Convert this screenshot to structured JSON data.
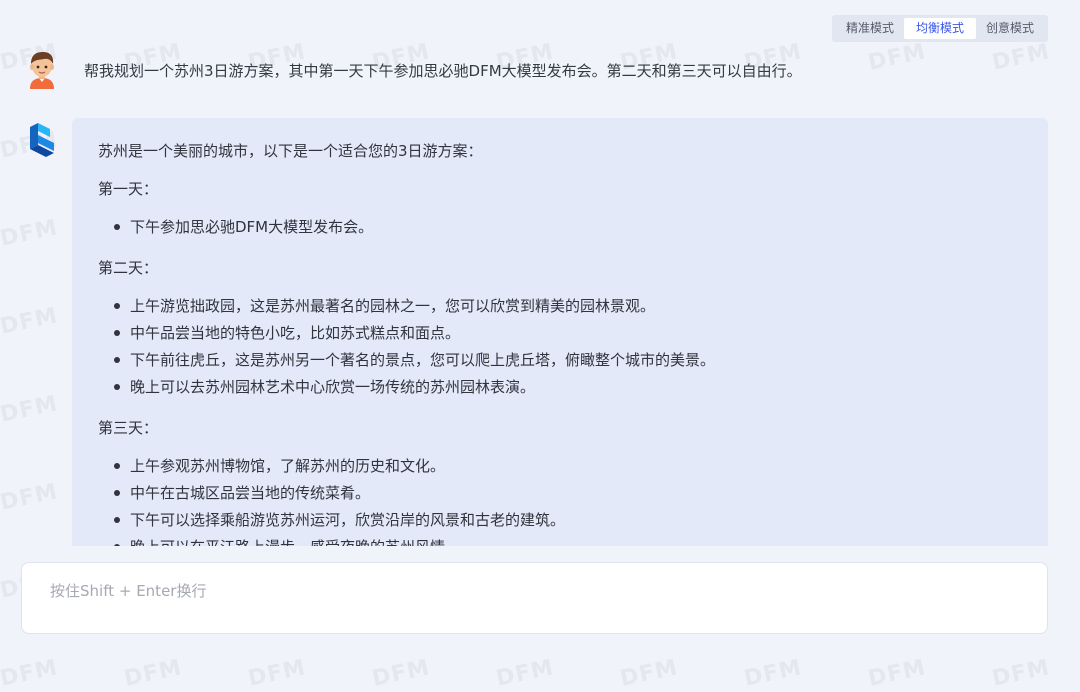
{
  "modes": {
    "items": [
      "精准模式",
      "均衡模式",
      "创意模式"
    ],
    "active": "均衡模式"
  },
  "watermark": {
    "text": "DFM"
  },
  "conversation": {
    "user": {
      "avatar_icon": "user-avatar-icon",
      "message": "帮我规划一个苏州3日游方案，其中第一天下午参加思必驰DFM大模型发布会。第二天和第三天可以自由行。"
    },
    "bot": {
      "avatar_icon": "dfm-logo-icon",
      "intro": "苏州是一个美丽的城市，以下是一个适合您的3日游方案：",
      "days": [
        {
          "title": "第一天：",
          "items": [
            "下午参加思必驰DFM大模型发布会。"
          ]
        },
        {
          "title": "第二天：",
          "items": [
            "上午游览拙政园，这是苏州最著名的园林之一，您可以欣赏到精美的园林景观。",
            "中午品尝当地的特色小吃，比如苏式糕点和面点。",
            "下午前往虎丘，这是苏州另一个著名的景点，您可以爬上虎丘塔，俯瞰整个城市的美景。",
            "晚上可以去苏州园林艺术中心欣赏一场传统的苏州园林表演。"
          ]
        },
        {
          "title": "第三天：",
          "items": [
            "上午参观苏州博物馆，了解苏州的历史和文化。",
            "中午在古城区品尝当地的传统菜肴。",
            "下午可以选择乘船游览苏州运河，欣赏沿岸的风景和古老的建筑。",
            "晚上可以在平江路上漫步，感受夜晚的苏州风情。"
          ]
        }
      ]
    }
  },
  "input": {
    "placeholder": "按住Shift + Enter换行",
    "value": ""
  },
  "colors": {
    "background": "#f1f3fa",
    "bubble": "#e3e9f8",
    "accent": "#3a56e8",
    "logo": "#1e88e5"
  }
}
